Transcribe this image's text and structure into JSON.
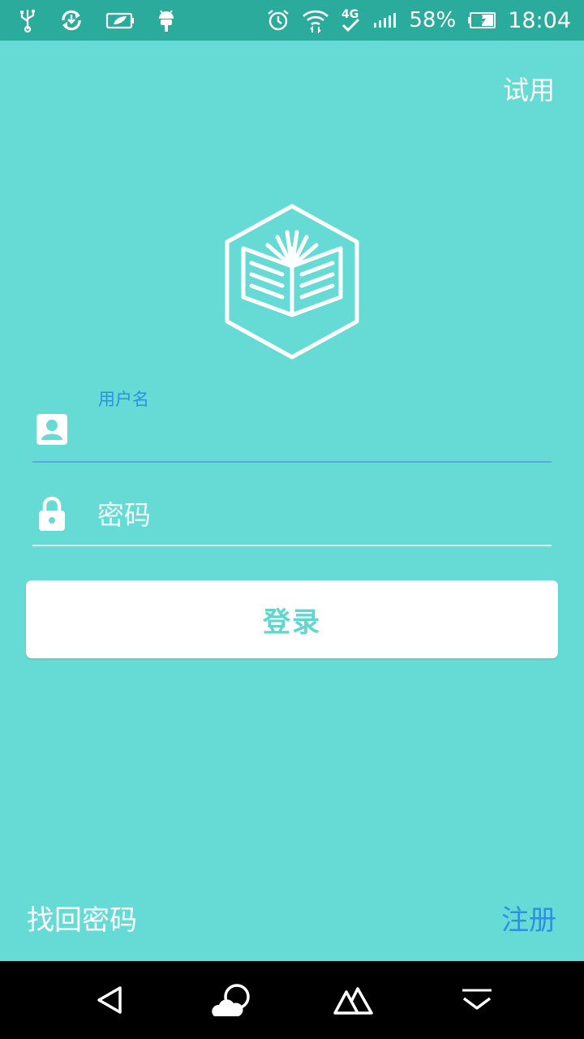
{
  "status_bar": {
    "battery_percent": "58%",
    "time": "18:04",
    "network": "4G",
    "icons_left": [
      "usb-icon",
      "sync-icon",
      "battery-saver-icon",
      "android-icon"
    ],
    "icons_right": [
      "alarm-icon",
      "wifi-icon",
      "network-4g-icon",
      "signal-icon",
      "battery-icon"
    ]
  },
  "header": {
    "trial_label": "试用"
  },
  "logo": {
    "icon": "book-hexagon-logo"
  },
  "form": {
    "username": {
      "label": "用户名",
      "value": "",
      "icon": "user-card-icon"
    },
    "password": {
      "placeholder": "密码",
      "value": "",
      "icon": "lock-icon"
    },
    "login_label": "登录"
  },
  "footer": {
    "forgot_label": "找回密码",
    "register_label": "注册"
  },
  "nav_bar": {
    "buttons": [
      "back-icon",
      "cloud-icon",
      "mountain-icon",
      "dropdown-icon"
    ]
  },
  "colors": {
    "background": "#66dbd5",
    "status_bar": "#2bab9c",
    "accent_blue": "#2f8fe0",
    "button_text": "#5fd6cf"
  }
}
